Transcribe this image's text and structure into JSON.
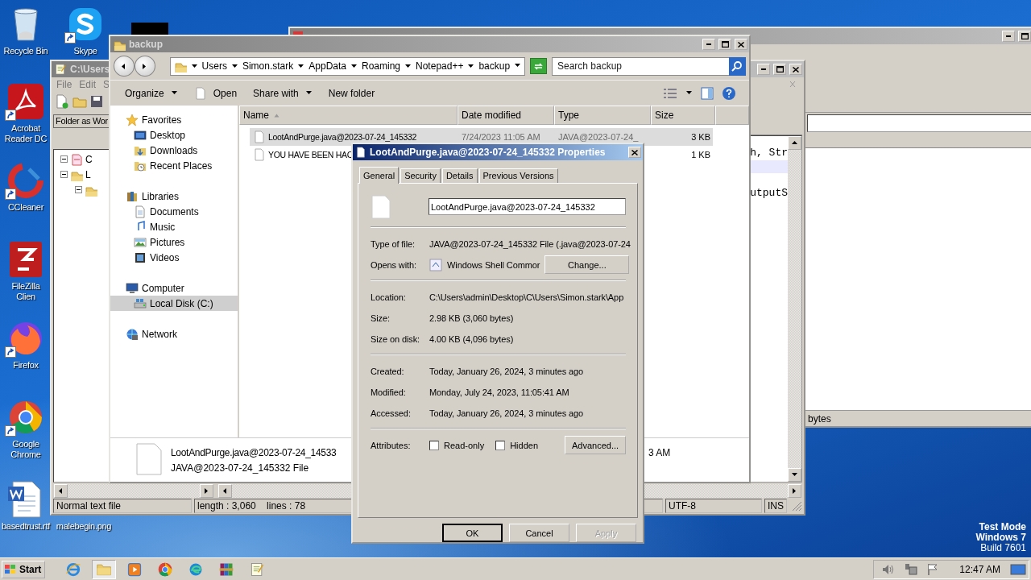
{
  "desktop": {
    "icons": [
      {
        "label": "Recycle Bin",
        "kind": "recycle",
        "shortcut": false
      },
      {
        "label": "Skype",
        "kind": "skype",
        "shortcut": true
      },
      {
        "label": "Acrobat Reader DC",
        "kind": "acrobat",
        "shortcut": true
      },
      {
        "label": "CCleaner",
        "kind": "ccleaner",
        "shortcut": true
      },
      {
        "label": "FileZilla Clien",
        "kind": "filezilla",
        "shortcut": false
      },
      {
        "label": "Firefox",
        "kind": "firefox",
        "shortcut": true
      },
      {
        "label": "Google Chrome",
        "kind": "chrome",
        "shortcut": true
      },
      {
        "label": "basedtrust.rtf",
        "kind": "word",
        "shortcut": false
      },
      {
        "label": "malebegin.png",
        "shortcut": false
      }
    ],
    "notice": [
      "Test Mode",
      "Windows 7",
      "Build 7601"
    ]
  },
  "background_window": {
    "status": "bytes"
  },
  "notepad": {
    "title": "C:\\Users",
    "menu": [
      "File",
      "Edit",
      "S"
    ],
    "panel_title": "Folder as Wor",
    "tree": [
      {
        "label": "C",
        "kind": "root",
        "expanded": true,
        "children": [
          {
            "label": "L",
            "kind": "folder",
            "expanded": true,
            "children": [
              {
                "kind": "folder",
                "expanded": true
              }
            ]
          }
        ]
      }
    ],
    "editor_lines": [
      {
        "text": "h, Str",
        "highlighted": false
      },
      {
        "highlighted": true
      },
      {
        "highlighted": false
      },
      {
        "text": "utputS",
        "highlighted": false
      }
    ],
    "status": [
      "Normal text file",
      "length : 3,060    lines : 78",
      "UTF-8",
      "INS"
    ]
  },
  "explorer": {
    "title": "backup",
    "breadcrumb": [
      "Users",
      "Simon.stark",
      "AppData",
      "Roaming",
      "Notepad++",
      "backup"
    ],
    "search": {
      "placeholder": "Search backup"
    },
    "commands": [
      {
        "label": "Organize",
        "kind": "menu"
      },
      {
        "label": "Open",
        "kind": "open"
      },
      {
        "label": "Share with",
        "kind": "menu"
      },
      {
        "label": "New folder",
        "kind": "plain"
      }
    ],
    "nav": [
      {
        "label": "Favorites",
        "kind": "star",
        "selected": false,
        "children": [
          {
            "label": "Desktop",
            "kind": "desktop",
            "selected": false
          },
          {
            "label": "Downloads",
            "kind": "downloads",
            "selected": false
          },
          {
            "label": "Recent Places",
            "kind": "recent",
            "selected": false
          }
        ]
      },
      {
        "label": "Libraries",
        "kind": "library",
        "selected": false,
        "children": [
          {
            "label": "Documents",
            "kind": "documents",
            "selected": false
          },
          {
            "label": "Music",
            "kind": "music",
            "selected": false
          },
          {
            "label": "Pictures",
            "kind": "pictures",
            "selected": false
          },
          {
            "label": "Videos",
            "kind": "videos",
            "selected": false
          }
        ]
      },
      {
        "label": "Computer",
        "kind": "computer",
        "selected": false,
        "children": [
          {
            "label": "Local Disk (C:)",
            "kind": "disk",
            "selected": true
          }
        ]
      },
      {
        "label": "Network",
        "kind": "network",
        "selected": false
      }
    ],
    "columns": [
      {
        "label": "Name",
        "sorted": true
      },
      {
        "label": "Date modified",
        "sorted": false
      },
      {
        "label": "Type",
        "sorted": false
      },
      {
        "label": "Size",
        "sorted": false
      }
    ],
    "files": [
      {
        "name": "LootAndPurge.java@2023-07-24_145332",
        "date": "7/24/2023 11:05 AM",
        "type": "JAVA@2023-07-24_",
        "size": "3 KB",
        "selected": true
      },
      {
        "name": "YOU HAVE BEEN HAC",
        "size": "1 KB",
        "selected": false
      }
    ],
    "details": {
      "name": "LootAndPurge.java@2023-07-24_14533",
      "type": "JAVA@2023-07-24_145332 File",
      "date": "3 AM"
    }
  },
  "properties": {
    "title": "LootAndPurge.java@2023-07-24_145332 Properties",
    "tabs": [
      {
        "label": "General",
        "selected": true
      },
      {
        "label": "Security",
        "selected": false
      },
      {
        "label": "Details",
        "selected": false
      },
      {
        "label": "Previous Versions",
        "selected": false
      }
    ],
    "filename": "LootAndPurge.java@2023-07-24_145332",
    "sections": [
      [
        {
          "label": "Type of file:",
          "value": "JAVA@2023-07-24_145332 File (.java@2023-07-24",
          "kind": "text"
        },
        {
          "label": "Opens with:",
          "value": "Windows Shell Commor",
          "kind": "app",
          "button": "Change..."
        }
      ],
      [
        {
          "label": "Location:",
          "value": "C:\\Users\\admin\\Desktop\\C\\Users\\Simon.stark\\App",
          "kind": "text"
        },
        {
          "label": "Size:",
          "value": "2.98 KB (3,060 bytes)",
          "kind": "text"
        },
        {
          "label": "Size on disk:",
          "value": "4.00 KB (4,096 bytes)",
          "kind": "text"
        }
      ],
      [
        {
          "label": "Created:",
          "value": "Today, January 26, 2024, 3 minutes ago",
          "kind": "text"
        },
        {
          "label": "Modified:",
          "value": "Monday, July 24, 2023, 11:05:41 AM",
          "kind": "text"
        },
        {
          "label": "Accessed:",
          "value": "Today, January 26, 2024, 3 minutes ago",
          "kind": "text"
        }
      ]
    ],
    "attributes": {
      "label": "Attributes:",
      "options": [
        {
          "label": "Read-only",
          "checked": false
        },
        {
          "label": "Hidden",
          "checked": false
        }
      ],
      "button": "Advanced..."
    },
    "buttons": [
      {
        "label": "OK",
        "disabled": false,
        "default": true
      },
      {
        "label": "Cancel",
        "disabled": false,
        "default": false
      },
      {
        "label": "Apply",
        "disabled": true,
        "default": false
      }
    ]
  },
  "taskbar": {
    "start": "Start",
    "apps": [
      {
        "kind": "ie",
        "selected": false
      },
      {
        "kind": "explorer",
        "selected": true
      },
      {
        "kind": "media",
        "selected": false
      },
      {
        "kind": "chrome",
        "selected": false
      },
      {
        "kind": "edge",
        "selected": false
      },
      {
        "kind": "winrar",
        "selected": false
      },
      {
        "kind": "notepad",
        "selected": false
      }
    ],
    "clock": "12:47 AM"
  }
}
